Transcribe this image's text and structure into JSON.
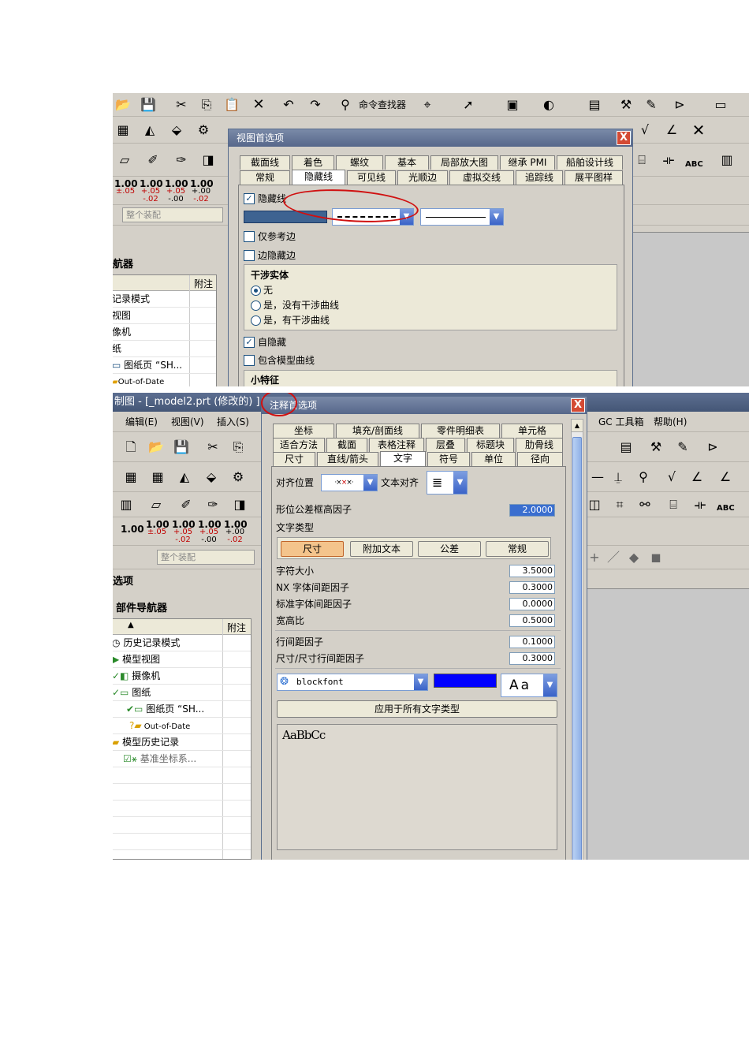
{
  "shot1": {
    "toolbar_finder_label": "命令查找器",
    "tolerances": [
      {
        "v": "1.00",
        "t": "±.05"
      },
      {
        "v": "1.00",
        "t": "+.05",
        "b": "-.02"
      },
      {
        "v": "1.00",
        "t": "+.05",
        "b": "-.00"
      },
      {
        "v": "1.00",
        "t": "+.00",
        "b": "-.02"
      }
    ],
    "filter_value": "整个装配",
    "nav_title": "航器",
    "nav_col_attach": "附注",
    "nav_rows": [
      "记录模式",
      "视图",
      "像机",
      "纸",
      "图纸页 “SH...",
      "Out-of-Date"
    ],
    "dialog": {
      "title": "视图首选项",
      "close": "X",
      "tabs_row1": [
        "截面线",
        "着色",
        "螺纹",
        "基本",
        "局部放大图",
        "继承 PMI",
        "船舶设计线"
      ],
      "tabs_row2": [
        "常规",
        "隐藏线",
        "可见线",
        "光顺边",
        "虚拟交线",
        "追踪线",
        "展平图样"
      ],
      "hidden_line_label": "隐藏线",
      "hidden_line_checked": "✓",
      "ref_edges_only": "仅参考边",
      "edge_hidden_edges": "边隐藏边",
      "interference_title": "干涉实体",
      "radio_none": "无",
      "radio_yes_no_curve": "是，没有干涉曲线",
      "radio_yes_curve": "是，有干涉曲线",
      "self_hidden": "自隐藏",
      "self_hidden_checked": "✓",
      "include_model_curves": "包含模型曲线",
      "small_features": "小特征",
      "dropdown_arrow": "▼"
    }
  },
  "shot2": {
    "title_bar": "制图 - [_model2.prt  (修改的) ]",
    "menus": [
      "编辑(E)",
      "视图(V)",
      "插入(S)"
    ],
    "right_menus": [
      "GC 工具箱",
      "帮助(H)"
    ],
    "tolerances": [
      {
        "v": "1.00",
        "t": "",
        "b": ""
      },
      {
        "v": "1.00",
        "t": "±.05",
        "b": ""
      },
      {
        "v": "1.00",
        "t": "+.05",
        "b": "-.02"
      },
      {
        "v": "1.00",
        "t": "+.05",
        "b": "-.00"
      },
      {
        "v": "1.00",
        "t": "+.00",
        "b": "-.02"
      }
    ],
    "filter_value": "整个装配",
    "section_label": "选项",
    "nav_title": "部件导航器",
    "nav_col_attach": "附注",
    "nav_rows": [
      {
        "text": "历史记录模式",
        "icon": "history-icon"
      },
      {
        "text": "模型视图",
        "icon": "model-view-icon"
      },
      {
        "text": "摄像机",
        "icon": "camera-icon"
      },
      {
        "text": "图纸",
        "icon": "drawing-icon"
      },
      {
        "text": "图纸页 “SH...",
        "icon": "sheet-icon"
      },
      {
        "text": "Out-of-Date",
        "icon": "folder-icon"
      },
      {
        "text": "模型历史记录",
        "icon": "folder-icon"
      },
      {
        "text": "基准坐标系...",
        "icon": "datum-icon"
      }
    ],
    "dialog": {
      "title": "注释首选项",
      "close": "X",
      "tabs_row1": [
        "坐标",
        "填充/剖面线",
        "零件明细表",
        "单元格"
      ],
      "tabs_row2": [
        "适合方法",
        "截面",
        "表格注释",
        "层叠",
        "标题块",
        "肋骨线"
      ],
      "tabs_row3": [
        "尺寸",
        "直线/箭头",
        "文字",
        "符号",
        "单位",
        "径向"
      ],
      "align_pos_label": "对齐位置",
      "text_align_label": "文本对齐",
      "gdt_frame_label": "形位公差框高因子",
      "gdt_frame_value": "2.0000",
      "text_type_label": "文字类型",
      "type_buttons": [
        "尺寸",
        "附加文本",
        "公差",
        "常规"
      ],
      "fields": [
        {
          "label": "字符大小",
          "value": "3.5000"
        },
        {
          "label": "NX 字体间距因子",
          "value": "0.3000"
        },
        {
          "label": "标准字体间距因子",
          "value": "0.0000"
        },
        {
          "label": "宽高比",
          "value": "0.5000"
        }
      ],
      "fields2": [
        {
          "label": "行间距因子",
          "value": "0.1000"
        },
        {
          "label": "尺寸/尺寸行间距因子",
          "value": "0.3000"
        }
      ],
      "font_value": "blockfont",
      "font_color": "#0000ff",
      "font_style_value": "Aa",
      "apply_all_button": "应用于所有文字类型",
      "preview_text": "AaBbCc",
      "dropdown_arrow": "▼"
    }
  }
}
